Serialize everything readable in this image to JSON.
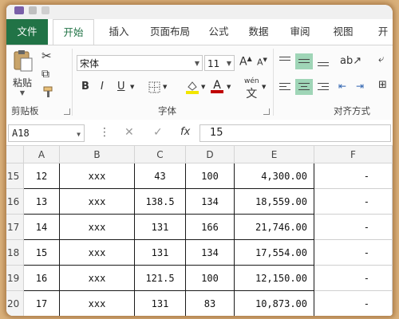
{
  "ribbon": {
    "tabs": [
      "文件",
      "开始",
      "插入",
      "页面布局",
      "公式",
      "数据",
      "审阅",
      "视图",
      "开"
    ],
    "clipboard": {
      "paste_label": "粘贴",
      "group_label": "剪贴板"
    },
    "font": {
      "name": "宋体",
      "size": "11",
      "bold": "B",
      "italic": "I",
      "underline": "U",
      "phonetic": "wén",
      "group_label": "字体",
      "highlight_color": "#f2e600",
      "font_color": "#c00000"
    },
    "alignment": {
      "group_label": "对齐方式"
    },
    "active_color": "#217346"
  },
  "formula_bar": {
    "name_box": "A18",
    "cancel_icon": "✕",
    "enter_icon": "✓",
    "fx_label": "fx",
    "formula": "15"
  },
  "sheet": {
    "columns": [
      "A",
      "B",
      "C",
      "D",
      "E",
      "F"
    ],
    "rows": [
      {
        "num": "15",
        "a": "12",
        "b": "xxx",
        "c": "43",
        "d": "100",
        "e": "4,300.00",
        "f": "-"
      },
      {
        "num": "16",
        "a": "13",
        "b": "xxx",
        "c": "138.5",
        "d": "134",
        "e": "18,559.00",
        "f": "-"
      },
      {
        "num": "17",
        "a": "14",
        "b": "xxx",
        "c": "131",
        "d": "166",
        "e": "21,746.00",
        "f": "-"
      },
      {
        "num": "18",
        "a": "15",
        "b": "xxx",
        "c": "131",
        "d": "134",
        "e": "17,554.00",
        "f": "-"
      },
      {
        "num": "19",
        "a": "16",
        "b": "xxx",
        "c": "121.5",
        "d": "100",
        "e": "12,150.00",
        "f": "-"
      },
      {
        "num": "20",
        "a": "17",
        "b": "xxx",
        "c": "131",
        "d": "83",
        "e": "10,873.00",
        "f": "-"
      }
    ]
  }
}
